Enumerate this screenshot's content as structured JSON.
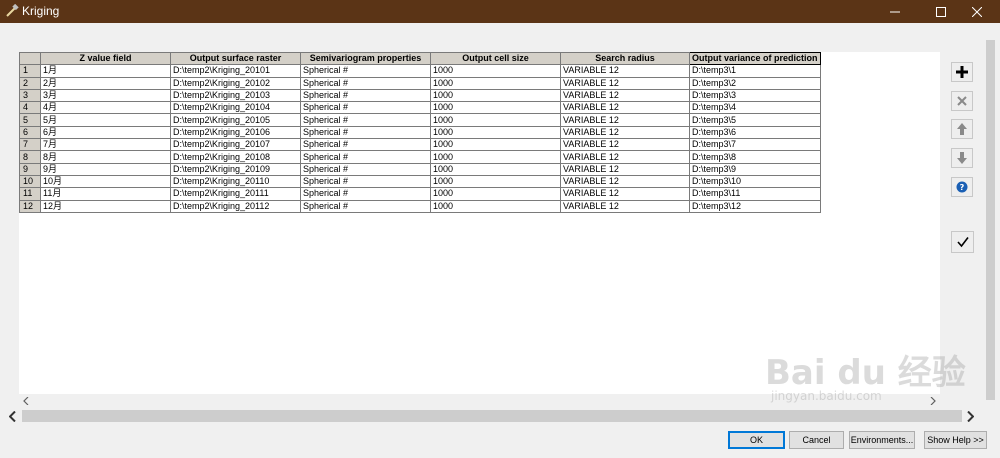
{
  "window": {
    "title": "Kriging"
  },
  "grid": {
    "columns": [
      "Z value field",
      "Output surface raster",
      "Semivariogram properties",
      "Output cell size",
      "Search radius",
      "Output variance of prediction"
    ],
    "rows": [
      {
        "n": "1",
        "cells": [
          "1月",
          "D:\\temp2\\Kriging_20101",
          "Spherical #",
          "1000",
          "VARIABLE 12",
          "D:\\temp3\\1"
        ]
      },
      {
        "n": "2",
        "cells": [
          "2月",
          "D:\\temp2\\Kriging_20102",
          "Spherical #",
          "1000",
          "VARIABLE 12",
          "D:\\temp3\\2"
        ]
      },
      {
        "n": "3",
        "cells": [
          "3月",
          "D:\\temp2\\Kriging_20103",
          "Spherical #",
          "1000",
          "VARIABLE 12",
          "D:\\temp3\\3"
        ]
      },
      {
        "n": "4",
        "cells": [
          "4月",
          "D:\\temp2\\Kriging_20104",
          "Spherical #",
          "1000",
          "VARIABLE 12",
          "D:\\temp3\\4"
        ]
      },
      {
        "n": "5",
        "cells": [
          "5月",
          "D:\\temp2\\Kriging_20105",
          "Spherical #",
          "1000",
          "VARIABLE 12",
          "D:\\temp3\\5"
        ]
      },
      {
        "n": "6",
        "cells": [
          "6月",
          "D:\\temp2\\Kriging_20106",
          "Spherical #",
          "1000",
          "VARIABLE 12",
          "D:\\temp3\\6"
        ]
      },
      {
        "n": "7",
        "cells": [
          "7月",
          "D:\\temp2\\Kriging_20107",
          "Spherical #",
          "1000",
          "VARIABLE 12",
          "D:\\temp3\\7"
        ]
      },
      {
        "n": "8",
        "cells": [
          "8月",
          "D:\\temp2\\Kriging_20108",
          "Spherical #",
          "1000",
          "VARIABLE 12",
          "D:\\temp3\\8"
        ]
      },
      {
        "n": "9",
        "cells": [
          "9月",
          "D:\\temp2\\Kriging_20109",
          "Spherical #",
          "1000",
          "VARIABLE 12",
          "D:\\temp3\\9"
        ]
      },
      {
        "n": "10",
        "cells": [
          "10月",
          "D:\\temp2\\Kriging_20110",
          "Spherical #",
          "1000",
          "VARIABLE 12",
          "D:\\temp3\\10"
        ]
      },
      {
        "n": "11",
        "cells": [
          "11月",
          "D:\\temp2\\Kriging_20111",
          "Spherical #",
          "1000",
          "VARIABLE 12",
          "D:\\temp3\\11"
        ]
      },
      {
        "n": "12",
        "cells": [
          "12月",
          "D:\\temp2\\Kriging_20112",
          "Spherical #",
          "1000",
          "VARIABLE 12",
          "D:\\temp3\\12"
        ]
      }
    ]
  },
  "side_toolbar": {
    "icons": [
      "add-icon",
      "delete-icon",
      "move-up-icon",
      "move-down-icon",
      "help-icon",
      "check-icon"
    ]
  },
  "buttons": {
    "ok": "OK",
    "cancel": "Cancel",
    "environments": "Environments...",
    "show_help": "Show Help >>"
  },
  "watermark": {
    "main": "Bai du 经验",
    "sub": "jingyan.baidu.com"
  },
  "colors": {
    "titlebar": "#5b3416",
    "header_bg": "#d4d0c8",
    "accent": "#0078d7",
    "help_blue": "#1a5fb4"
  }
}
